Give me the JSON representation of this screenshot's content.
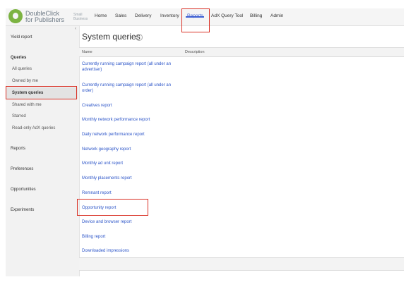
{
  "brand": {
    "line1": "DoubleClick",
    "line2": "for Publishers",
    "sub": "Small Business"
  },
  "nav": [
    "Home",
    "Sales",
    "Delivery",
    "Inventory",
    "Reports",
    "AdX Query Tool",
    "Billing",
    "Admin"
  ],
  "nav_active": "Reports",
  "sidebar": {
    "yield_report": "Yield report",
    "queries": "Queries",
    "query_items": [
      "All queries",
      "Owned by me",
      "System queries",
      "Shared with me",
      "Starred",
      "Read-only AdX queries"
    ],
    "selected": "System queries",
    "sections": [
      "Reports",
      "Preferences",
      "Opportunities",
      "Experiments"
    ]
  },
  "main": {
    "title": "System queries",
    "help_icon": "?",
    "columns": [
      "Name",
      "Description"
    ],
    "rows": [
      "Currently running campaign report (all under an advertiser)",
      "Currently running campaign report (all under an order)",
      "Creatives report",
      "Monthly network performance report",
      "Daily network performance report",
      "Network geography report",
      "Monthly ad unit report",
      "Monthly placements report",
      "Remnant report",
      "Opportunity report",
      "Device and browser report",
      "Billing report",
      "Downloaded impressions"
    ]
  },
  "colors": {
    "accent": "#3d5fd3",
    "link": "#2c55c8",
    "highlight": "#d93025"
  }
}
